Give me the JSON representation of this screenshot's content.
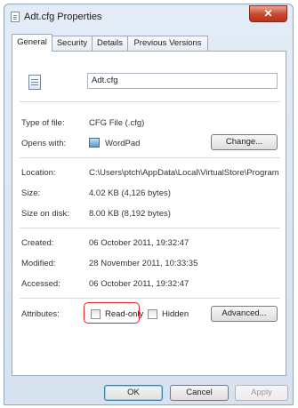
{
  "window": {
    "title": "Adt.cfg Properties",
    "close_glyph": "✕"
  },
  "tabs": [
    {
      "label": "General",
      "active": true
    },
    {
      "label": "Security",
      "active": false
    },
    {
      "label": "Details",
      "active": false
    },
    {
      "label": "Previous Versions",
      "active": false
    }
  ],
  "general": {
    "file_name": "Adt.cfg",
    "type_of_file": {
      "label": "Type of file:",
      "value": "CFG File (.cfg)"
    },
    "opens_with": {
      "label": "Opens with:",
      "value": "WordPad",
      "icon": "wordpad-icon",
      "change_button": "Change..."
    },
    "location": {
      "label": "Location:",
      "value": "C:\\Users\\ptch\\AppData\\Local\\VirtualStore\\Program"
    },
    "size": {
      "label": "Size:",
      "value": "4.02 KB (4,126 bytes)"
    },
    "size_on_disk": {
      "label": "Size on disk:",
      "value": "8.00 KB (8,192 bytes)"
    },
    "created": {
      "label": "Created:",
      "value": "06 October 2011, 19:32:47"
    },
    "modified": {
      "label": "Modified:",
      "value": "28 November 2011, 10:33:35"
    },
    "accessed": {
      "label": "Accessed:",
      "value": "06 October 2011, 19:32:47"
    },
    "attributes": {
      "label": "Attributes:",
      "read_only": {
        "label": "Read-only",
        "checked": false
      },
      "hidden": {
        "label": "Hidden",
        "checked": false
      },
      "advanced_button": "Advanced..."
    }
  },
  "footer": {
    "ok": "OK",
    "cancel": "Cancel",
    "apply": "Apply"
  },
  "colors": {
    "highlight": "#e02020",
    "close_button": "#c7462c"
  }
}
